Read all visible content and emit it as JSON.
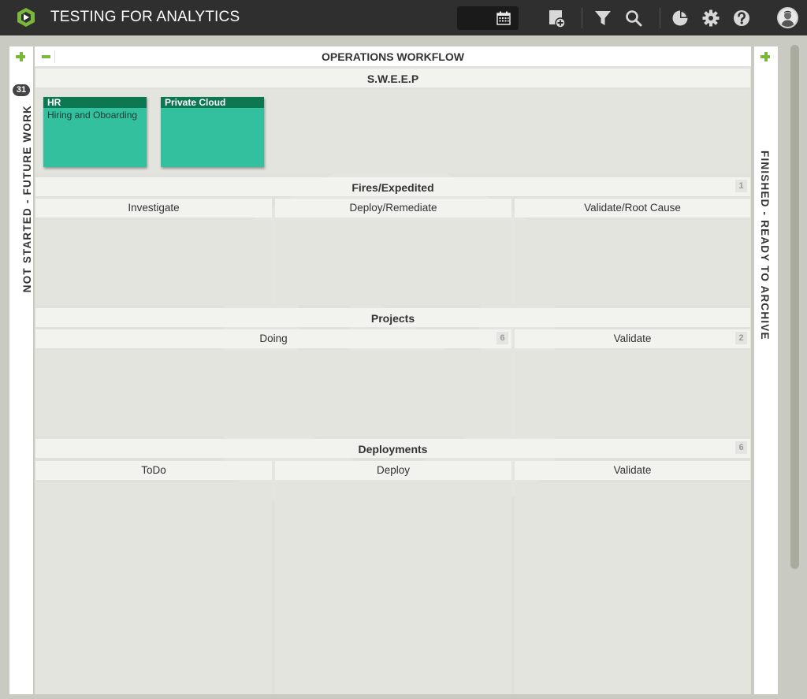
{
  "app": {
    "title": "TESTING FOR ANALYTICS"
  },
  "toolbar": {
    "icons": [
      "board-view-icon",
      "calendar-icon",
      "add-card-icon",
      "filter-icon",
      "search-icon",
      "analytics-icon",
      "gear-icon",
      "help-icon",
      "avatar"
    ]
  },
  "left_lane": {
    "count": "31",
    "title": "NOT STARTED - FUTURE WORK"
  },
  "right_lane": {
    "title": "FINISHED - READY TO ARCHIVE"
  },
  "board": {
    "title": "OPERATIONS WORKFLOW",
    "lanes": {
      "sweep": {
        "title": "S.W.E.E.P"
      },
      "fires": {
        "title": "Fires/Expedited",
        "wip": "1",
        "sub": [
          "Investigate",
          "Deploy/Remediate",
          "Validate/Root Cause"
        ]
      },
      "projects": {
        "title": "Projects",
        "sub": [
          "Doing",
          "Validate"
        ],
        "sub_wip": [
          "6",
          "2"
        ]
      },
      "deployments": {
        "title": "Deployments",
        "wip": "6",
        "sub": [
          "ToDo",
          "Deploy",
          "Validate"
        ]
      }
    },
    "cards": [
      {
        "type": "HR",
        "title": "Hiring and Oboarding"
      },
      {
        "type": "Private Cloud",
        "title": ""
      }
    ]
  },
  "colors": {
    "accent": "#7ab83a",
    "card": "#33c09e",
    "card_header": "#0d7752",
    "topbar": "#2f2f2f"
  }
}
